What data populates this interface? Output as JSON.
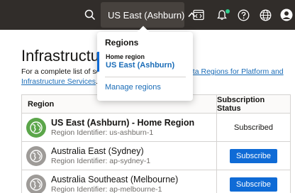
{
  "header": {
    "region_selector": "US East (Ashburn)",
    "icons": [
      "search-icon",
      "chevron-up-icon",
      "code-editor-icon",
      "bell-icon",
      "help-icon",
      "globe-icon",
      "user-icon"
    ]
  },
  "regions_menu": {
    "title": "Regions",
    "home_label": "Home region",
    "home_value": "US East (Ashburn)",
    "manage_link": "Manage regions"
  },
  "main": {
    "title": "Infrastructure",
    "intro_prefix": "For a complete list of ser",
    "intro_link_end": "ata Regions for Platform and",
    "intro_link_line2": "Infrastructure Services",
    "intro_suffix": "."
  },
  "table": {
    "col_region": "Region",
    "col_status": "Subscription Status",
    "rows": [
      {
        "name": "US East (Ashburn) - Home Region",
        "identifier": "Region Identifier: us-ashburn-1",
        "status": "Subscribed",
        "home": true
      },
      {
        "name": "Australia East (Sydney)",
        "identifier": "Region Identifier: ap-sydney-1",
        "status": "Subscribe",
        "home": false
      },
      {
        "name": "Australia Southeast (Melbourne)",
        "identifier": "Region Identifier: ap-melbourne-1",
        "status": "Subscribe",
        "home": false
      }
    ]
  },
  "colors": {
    "topbar": "#312d2a",
    "link": "#1a6cb7",
    "button": "#0f6bd6",
    "home_globe": "#5ba64a",
    "globe_gray": "#9e9b98",
    "notify_dot": "#2fcf8f"
  }
}
